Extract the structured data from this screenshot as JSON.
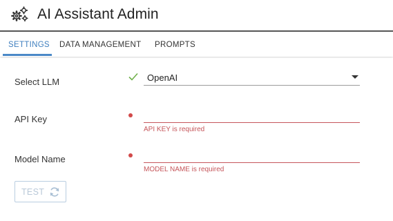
{
  "header": {
    "title": "AI Assistant Admin",
    "icon": "gears-icon"
  },
  "tabs": [
    {
      "label": "SETTINGS",
      "active": true
    },
    {
      "label": "DATA MANAGEMENT",
      "active": false
    },
    {
      "label": "PROMPTS",
      "active": false
    }
  ],
  "form": {
    "llm": {
      "label": "Select LLM",
      "value": "OpenAI",
      "status": "valid"
    },
    "api_key": {
      "label": "API Key",
      "value": "",
      "error": "API KEY is required"
    },
    "model_name": {
      "label": "Model Name",
      "value": "",
      "error": "MODEL NAME is required"
    },
    "test_button": {
      "label": "TEST",
      "icon": "refresh-icon",
      "disabled": true
    }
  },
  "colors": {
    "accent": "#4a88c7",
    "error": "#c5555a",
    "valid": "#6fb04a"
  }
}
